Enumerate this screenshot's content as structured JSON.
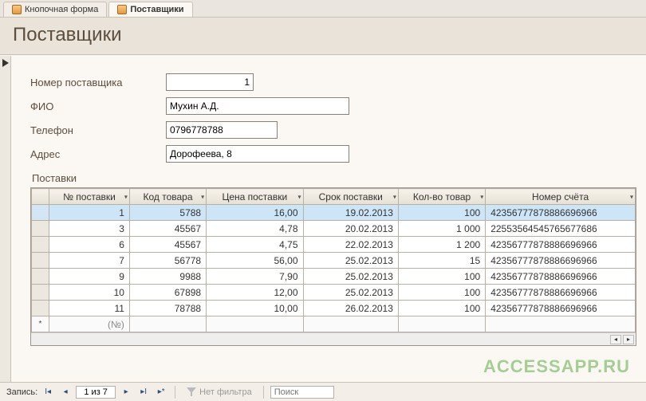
{
  "tabs": [
    {
      "label": "Кнопочная форма",
      "active": false
    },
    {
      "label": "Поставщики",
      "active": true
    }
  ],
  "form": {
    "title": "Поставщики",
    "fields": {
      "supplier_id": {
        "label": "Номер поставщика",
        "value": "1"
      },
      "fio": {
        "label": "ФИО",
        "value": "Мухин А.Д."
      },
      "phone": {
        "label": "Телефон",
        "value": "0796778788"
      },
      "address": {
        "label": "Адрес",
        "value": "Дорофеева, 8"
      }
    }
  },
  "subform": {
    "label": "Поставки",
    "columns": [
      "№ поставки",
      "Код товара",
      "Цена поставки",
      "Срок поставки",
      "Кол-во товар",
      "Номер счёта"
    ],
    "rows": [
      {
        "no": "1",
        "code": "5788",
        "price": "16,00",
        "date": "19.02.2013",
        "qty": "100",
        "acct": "42356777878886696966"
      },
      {
        "no": "3",
        "code": "45567",
        "price": "4,78",
        "date": "20.02.2013",
        "qty": "1 000",
        "acct": "22553564545765677686"
      },
      {
        "no": "6",
        "code": "45567",
        "price": "4,75",
        "date": "22.02.2013",
        "qty": "1 200",
        "acct": "42356777878886696966"
      },
      {
        "no": "7",
        "code": "56778",
        "price": "56,00",
        "date": "25.02.2013",
        "qty": "15",
        "acct": "42356777878886696966"
      },
      {
        "no": "9",
        "code": "9988",
        "price": "7,90",
        "date": "25.02.2013",
        "qty": "100",
        "acct": "42356777878886696966"
      },
      {
        "no": "10",
        "code": "67898",
        "price": "12,00",
        "date": "25.02.2013",
        "qty": "100",
        "acct": "42356777878886696966"
      },
      {
        "no": "11",
        "code": "78788",
        "price": "10,00",
        "date": "26.02.2013",
        "qty": "100",
        "acct": "42356777878886696966"
      }
    ],
    "newrow_placeholder": "(№)"
  },
  "nav": {
    "label": "Запись:",
    "position": "1 из 7",
    "filter_text": "Нет фильтра",
    "search_placeholder": "Поиск"
  },
  "watermark": "ACCESSAPP.RU"
}
